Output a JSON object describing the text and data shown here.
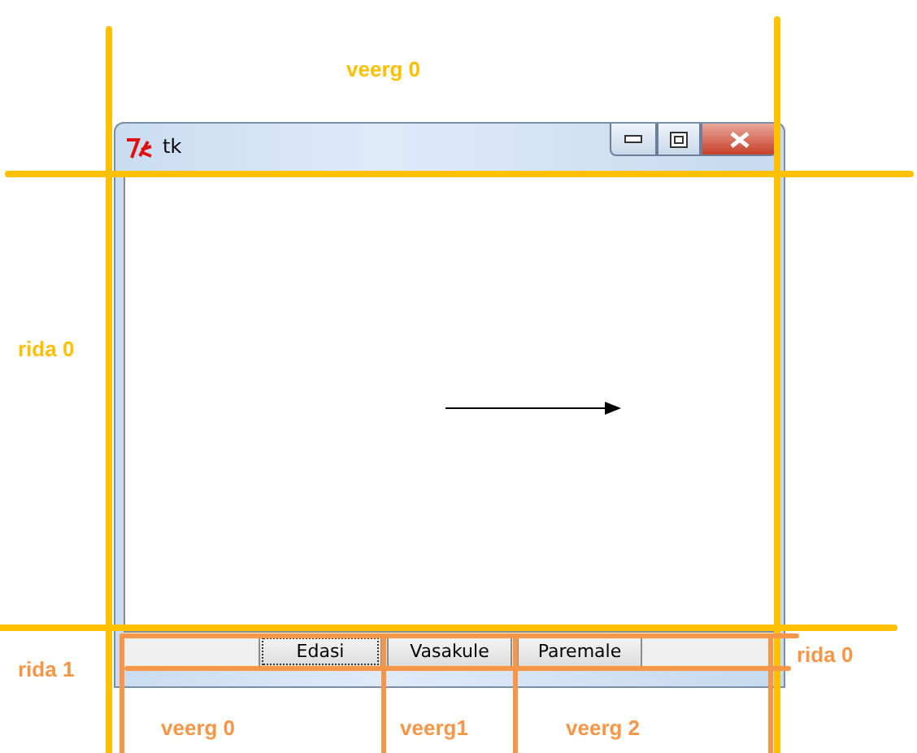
{
  "window": {
    "title": "tk"
  },
  "buttons": [
    {
      "label": "Edasi",
      "focused": true
    },
    {
      "label": "Vasakule",
      "focused": false
    },
    {
      "label": "Paremale",
      "focused": false
    }
  ],
  "annotations": [
    {
      "text": "veerg 0",
      "color": "#ffc000"
    },
    {
      "text": "rida 0",
      "color": "#ffc000"
    },
    {
      "text": "rida 1",
      "color": "#f79646"
    },
    {
      "text": "rida 0",
      "color": "#f79646"
    },
    {
      "text": "veerg 0",
      "color": "#f79646"
    },
    {
      "text": "veerg1",
      "color": "#f79646"
    },
    {
      "text": "veerg 2",
      "color": "#f79646"
    }
  ]
}
